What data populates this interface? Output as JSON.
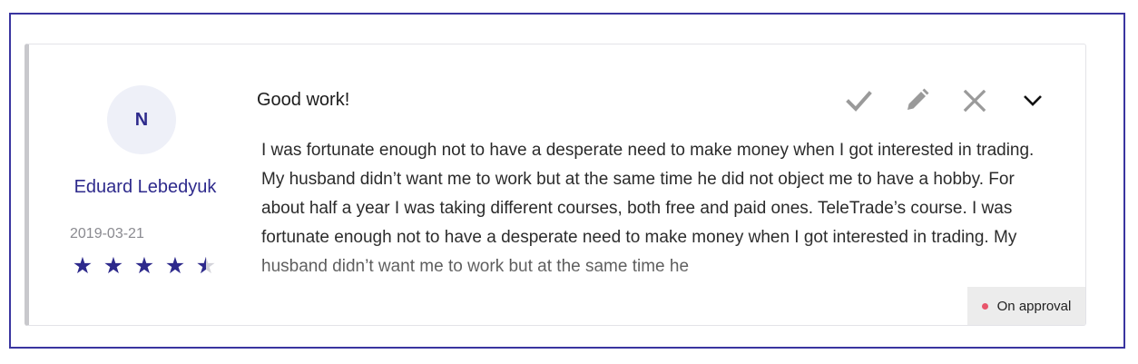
{
  "review": {
    "author": {
      "initial": "N",
      "name": "Eduard Lebedyuk",
      "date": "2019-03-21",
      "rating": 4.5,
      "max_rating": 5
    },
    "title": "Good work!",
    "body": "I was fortunate enough not to have a desperate need to make money when I got interested in trading. My husband didn’t want me to work but at the same time he did not object me to have a hobby. For about half a year I was taking different courses, both free and paid ones. TeleTrade’s course. I was fortunate enough not to have a desperate need to make money when I got interested in trading. My husband didn’t want me to work but at the same time he",
    "actions": [
      {
        "name": "approve",
        "icon": "check-icon"
      },
      {
        "name": "edit",
        "icon": "pencil-icon"
      },
      {
        "name": "reject",
        "icon": "close-icon"
      },
      {
        "name": "expand",
        "icon": "chevron-down-icon"
      }
    ],
    "status": {
      "label": "On approval",
      "color": "#e8556b"
    }
  },
  "colors": {
    "accent": "#2e2a8c",
    "frame": "#3a35a0",
    "icon_gray": "#9a9a9a"
  }
}
